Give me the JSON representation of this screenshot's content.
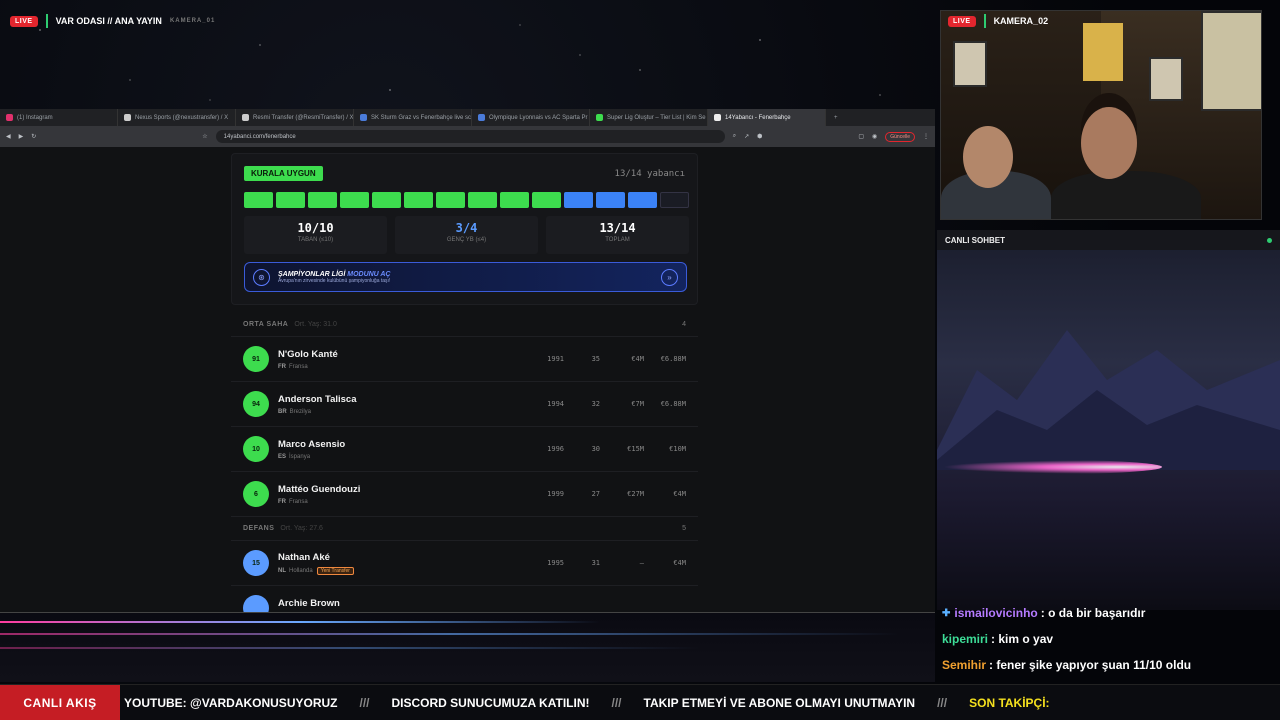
{
  "overlay": {
    "live_label": "LIVE",
    "main_title": "VAR ODASI // ANA YAYIN",
    "cam1_label": "KAMERA_01",
    "cam2_title": "KAMERA_02",
    "chat_title": "CANLI SOHBET"
  },
  "browser": {
    "tabs": [
      {
        "label": "(1) Instagram",
        "color": "#e1306c"
      },
      {
        "label": "Nexus Sports (@nexustransfer) / X",
        "color": "#cccccc"
      },
      {
        "label": "Resmi Transfer (@ResmiTransfer) / X",
        "color": "#cccccc"
      },
      {
        "label": "SK Sturm Graz vs Fenerbahçe live sc",
        "color": "#4a7bd9"
      },
      {
        "label": "Olympique Lyonnais vs AC Sparta Pr",
        "color": "#4a7bd9"
      },
      {
        "label": "Super Lig Oluştur – Tier List | Kim Se",
        "color": "#3ddc4e"
      },
      {
        "label": "14Yabancı - Fenerbahçe",
        "color": "#eeeeee"
      }
    ],
    "url": "14yabanci.com/fenerbahce",
    "update_label": "Güncelle"
  },
  "summary": {
    "rule_pill": "KURALA UYGUN",
    "foreign_count": "13/14 yabancı",
    "bars": [
      "green",
      "green",
      "green",
      "green",
      "green",
      "green",
      "green",
      "green",
      "green",
      "green",
      "blue",
      "blue",
      "blue",
      "empty"
    ],
    "colors": {
      "green": "#3ddc4e",
      "blue": "#3b82f6",
      "empty": "#1a1c24"
    },
    "stats": [
      {
        "value": "10/10",
        "label": "TABAN (≤10)",
        "color": "#ffffff"
      },
      {
        "value": "3/4",
        "label": "GENÇ YB (≤4)",
        "color": "#5b9bff"
      },
      {
        "value": "13/14",
        "label": "TOPLAM",
        "color": "#ffffff"
      }
    ],
    "banner_title_a": "ŞAMPİYONLAR LİGİ",
    "banner_title_b": "MODUNU AÇ",
    "banner_sub": "Avrupa'nın zirvesinde kulübünü şampiyonluğa taşı!"
  },
  "sections": [
    {
      "title": "ORTA SAHA",
      "sub": "Ort. Yaş: 31.0",
      "count": "4",
      "players": [
        {
          "num": "91",
          "name": "N'Golo Kanté",
          "cc": "FR",
          "country": "Fransa",
          "year": "1991",
          "age": "35",
          "val1": "€4M",
          "val2": "€6.88M",
          "color": "#3ddc4e",
          "badge": ""
        },
        {
          "num": "94",
          "name": "Anderson Talisca",
          "cc": "BR",
          "country": "Brezilya",
          "year": "1994",
          "age": "32",
          "val1": "€7M",
          "val2": "€6.88M",
          "color": "#3ddc4e",
          "badge": ""
        },
        {
          "num": "10",
          "name": "Marco Asensio",
          "cc": "ES",
          "country": "İspanya",
          "year": "1996",
          "age": "30",
          "val1": "€15M",
          "val2": "€10M",
          "color": "#3ddc4e",
          "badge": ""
        },
        {
          "num": "6",
          "name": "Mattéo Guendouzi",
          "cc": "FR",
          "country": "Fransa",
          "year": "1999",
          "age": "27",
          "val1": "€27M",
          "val2": "€4M",
          "color": "#3ddc4e",
          "badge": ""
        }
      ]
    },
    {
      "title": "DEFANS",
      "sub": "Ort. Yaş: 27.6",
      "count": "5",
      "players": [
        {
          "num": "15",
          "name": "Nathan Aké",
          "cc": "NL",
          "country": "Hollanda",
          "year": "1995",
          "age": "31",
          "val1": "–",
          "val2": "€4M",
          "color": "#5b9bff",
          "badge": "Yeni Transfer"
        },
        {
          "num": "",
          "name": "Archie Brown",
          "cc": "",
          "country": "",
          "year": "",
          "age": "",
          "val1": "",
          "val2": "",
          "color": "#5b9bff",
          "badge": ""
        }
      ]
    }
  ],
  "chat": {
    "messages": [
      {
        "user": "ismailovicinho",
        "text": ": o da bir başarıdır",
        "color": "#b57bff",
        "icon": true
      },
      {
        "user": "kipemiri",
        "text": ": kim o yav",
        "color": "#3ddc97",
        "icon": false
      },
      {
        "user": "Semihir",
        "text": ": fener şike yapıyor şuan 11/10 oldu",
        "color": "#f0a030",
        "icon": false
      }
    ]
  },
  "ticker": {
    "label": "CANLI AKIŞ",
    "items": [
      "YOUTUBE: @VARDAKONUSUYORUZ",
      "DISCORD SUNUCUMUZA KATILIN!",
      "TAKIP ETMEYİ VE ABONE OLMAYI UNUTMAYIN"
    ],
    "separator": "///",
    "last": "SON TAKİPÇİ:"
  }
}
